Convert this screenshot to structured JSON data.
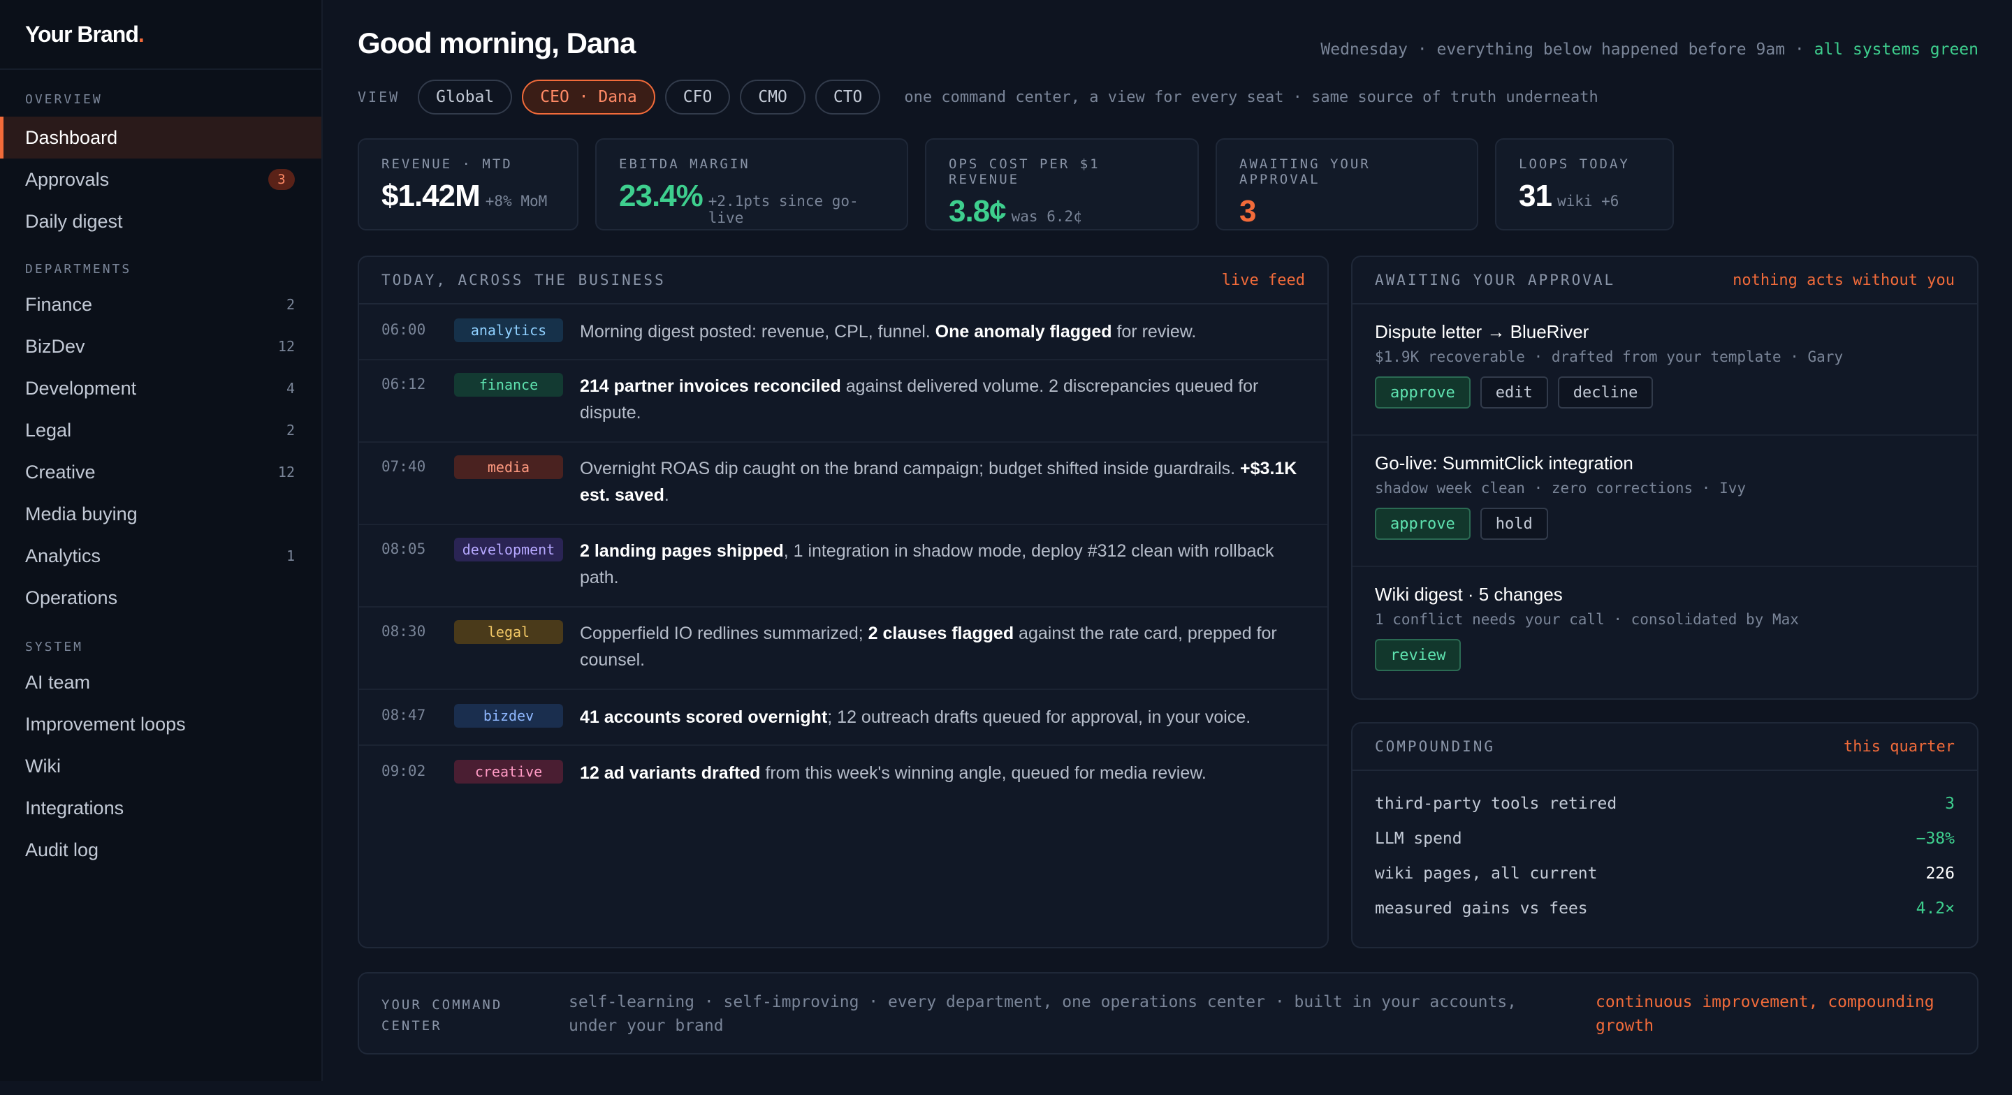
{
  "brand": {
    "name": "Your Brand",
    "dot": "."
  },
  "sidebar": {
    "overview_label": "OVERVIEW",
    "overview": [
      {
        "label": "Dashboard"
      },
      {
        "label": "Approvals",
        "badge": "3"
      },
      {
        "label": "Daily digest"
      }
    ],
    "departments_label": "DEPARTMENTS",
    "departments": [
      {
        "label": "Finance",
        "count": "2"
      },
      {
        "label": "BizDev",
        "count": "12"
      },
      {
        "label": "Development",
        "count": "4"
      },
      {
        "label": "Legal",
        "count": "2"
      },
      {
        "label": "Creative",
        "count": "12"
      },
      {
        "label": "Media buying",
        "count": ""
      },
      {
        "label": "Analytics",
        "count": "1"
      },
      {
        "label": "Operations",
        "count": ""
      }
    ],
    "system_label": "SYSTEM",
    "system": [
      {
        "label": "AI team"
      },
      {
        "label": "Improvement loops"
      },
      {
        "label": "Wiki"
      },
      {
        "label": "Integrations"
      },
      {
        "label": "Audit log"
      }
    ]
  },
  "header": {
    "greeting": "Good morning, Dana",
    "status_prefix": "Wednesday · everything below happened before 9am · ",
    "status_ok": "all systems green"
  },
  "view": {
    "label": "VIEW",
    "chips": [
      "Global",
      "CEO · Dana",
      "CFO",
      "CMO",
      "CTO"
    ],
    "note": "one command center, a view for every seat · same source of truth underneath"
  },
  "kpis": [
    {
      "label": "REVENUE · MTD",
      "value": "$1.42M",
      "sub": "+8% MoM"
    },
    {
      "label": "EBITDA MARGIN",
      "value": "23.4%",
      "sub": "+2.1pts since go-live"
    },
    {
      "label": "OPS COST PER $1 REVENUE",
      "value": "3.8¢",
      "sub": "was 6.2¢"
    },
    {
      "label": "AWAITING YOUR APPROVAL",
      "value": "3",
      "sub": ""
    },
    {
      "label": "LOOPS TODAY",
      "value": "31",
      "sub": "wiki +6"
    }
  ],
  "feed": {
    "title": "TODAY, ACROSS THE BUSINESS",
    "tag": "live feed",
    "items": [
      {
        "time": "06:00",
        "dept": "analytics",
        "pre": "Morning digest posted: revenue, CPL, funnel. ",
        "bold": "One anomaly flagged",
        "post": " for review."
      },
      {
        "time": "06:12",
        "dept": "finance",
        "pre": "",
        "bold": "214 partner invoices reconciled",
        "post": " against delivered volume. 2 discrepancies queued for dispute."
      },
      {
        "time": "07:40",
        "dept": "media",
        "pre": "Overnight ROAS dip caught on the brand campaign; budget shifted inside guardrails. ",
        "bold": "+$3.1K est. saved",
        "post": "."
      },
      {
        "time": "08:05",
        "dept": "development",
        "pre": "",
        "bold": "2 landing pages shipped",
        "post": ", 1 integration in shadow mode, deploy #312 clean with rollback path."
      },
      {
        "time": "08:30",
        "dept": "legal",
        "pre": "Copperfield IO redlines summarized; ",
        "bold": "2 clauses flagged",
        "post": " against the rate card, prepped for counsel."
      },
      {
        "time": "08:47",
        "dept": "bizdev",
        "pre": "",
        "bold": "41 accounts scored overnight",
        "post": "; 12 outreach drafts queued for approval, in your voice."
      },
      {
        "time": "09:02",
        "dept": "creative",
        "pre": "",
        "bold": "12 ad variants drafted",
        "post": " from this week's winning angle, queued for media review."
      }
    ]
  },
  "approvals": {
    "title": "AWAITING YOUR APPROVAL",
    "tag": "nothing acts without you",
    "items": [
      {
        "title": "Dispute letter → BlueRiver",
        "sub": "$1.9K recoverable · drafted from your template · Gary",
        "buttons": [
          "approve",
          "edit",
          "decline"
        ]
      },
      {
        "title": "Go-live: SummitClick integration",
        "sub": "shadow week clean · zero corrections · Ivy",
        "buttons": [
          "approve",
          "hold"
        ]
      },
      {
        "title": "Wiki digest · 5 changes",
        "sub": "1 conflict needs your call · consolidated by Max",
        "buttons": [
          "review"
        ]
      }
    ]
  },
  "compounding": {
    "title": "COMPOUNDING",
    "tag": "this quarter",
    "rows": [
      {
        "label": "third-party tools retired",
        "value": "3"
      },
      {
        "label": "LLM spend",
        "value": "−38%"
      },
      {
        "label": "wiki pages, all current",
        "value": "226"
      },
      {
        "label": "measured gains vs fees",
        "value": "4.2×"
      }
    ]
  },
  "footer": {
    "label": "YOUR COMMAND CENTER",
    "text": "self-learning · self-improving · every department, one operations center · built in your accounts, under your brand",
    "tag": "continuous improvement, compounding growth"
  },
  "colors": {
    "accent": "#f26b3a",
    "green": "#3ecf8e",
    "background": "#0e1420"
  }
}
